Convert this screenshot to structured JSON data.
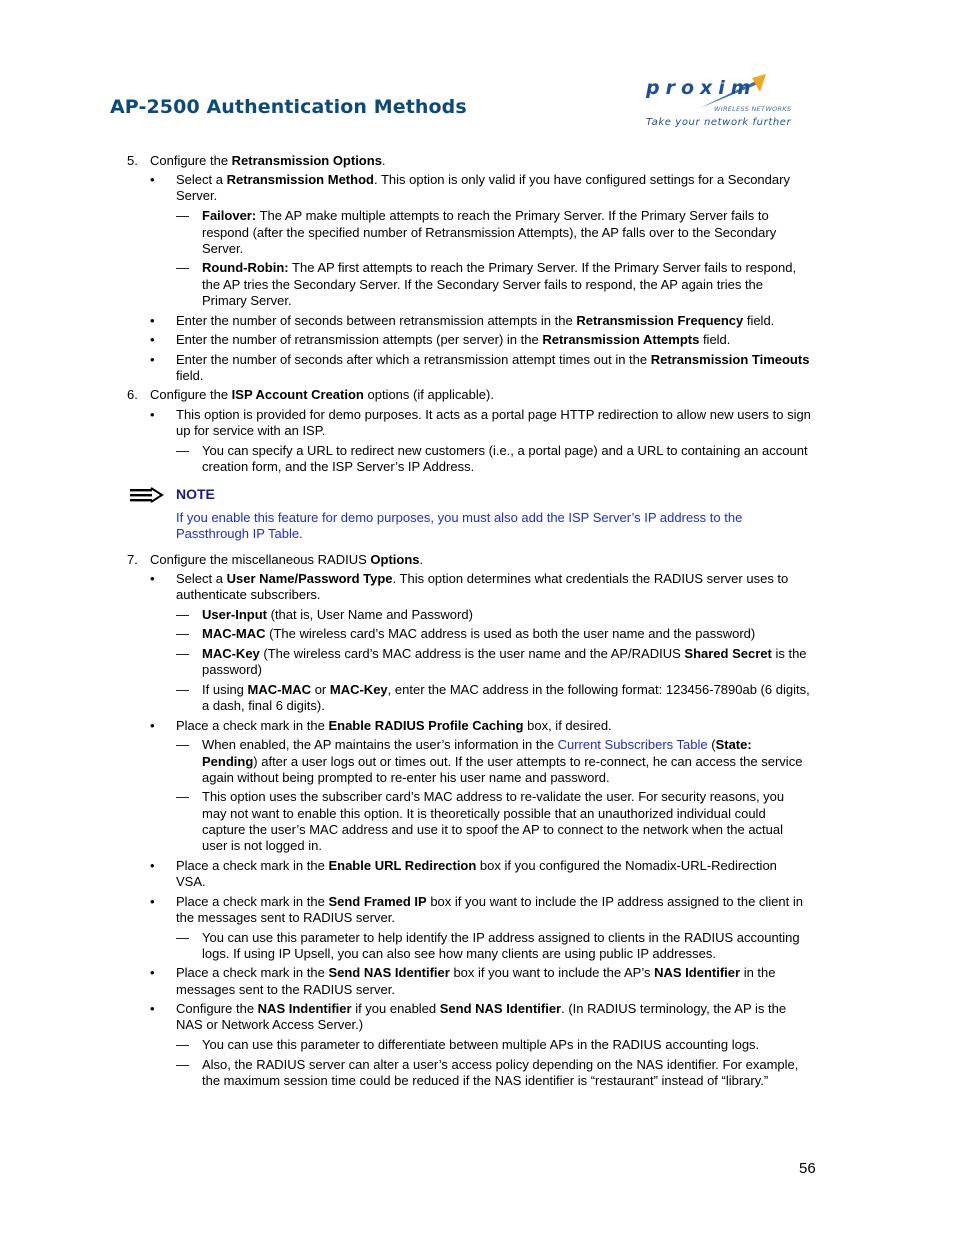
{
  "header": {
    "title": "AP-2500 Authentication Methods",
    "logo": {
      "wordmark": "proxim",
      "subtitle": "WIRELESS NETWORKS",
      "tagline": "Take your network further"
    }
  },
  "steps": {
    "s5": {
      "number": "5.",
      "pre": "Configure the ",
      "bold": "Retransmission Options",
      "post": ".",
      "b1": {
        "l1_pre": "Select a ",
        "l1_bold": "Retransmission Method",
        "l1_post": ". This option is only valid if you have configured settings for a Secondary",
        "l2": "Server.",
        "d1": {
          "l1_bold": "Failover:",
          "l1_post": " The AP make multiple attempts to reach the Primary Server. If the Primary Server fails to",
          "l2": "respond (after the specified number of Retransmission Attempts), the AP falls over to the Secondary",
          "l3": "Server."
        },
        "d2": {
          "l1_bold": "Round-Robin:",
          "l1_post": " The AP first attempts to reach the Primary Server. If the Primary Server fails to respond,",
          "l2": "the AP tries the Secondary Server. If the Secondary Server fails to respond, the AP again tries the",
          "l3": "Primary Server."
        }
      },
      "b2": {
        "pre": "Enter the number of seconds between retransmission attempts in the ",
        "bold": "Retransmission Frequency",
        "post": " field."
      },
      "b3": {
        "pre": "Enter the number of retransmission attempts (per server) in the ",
        "bold": "Retransmission Attempts",
        "post": " field."
      },
      "b4": {
        "pre": "Enter the number of seconds after which a retransmission attempt times out in the ",
        "bold": "Retransmission Timeouts",
        "l2": "field."
      }
    },
    "s6": {
      "number": "6.",
      "pre": "Configure the ",
      "bold": "ISP Account Creation",
      "post": " options (if applicable).",
      "b1": {
        "l1": "This option is provided for demo purposes. It acts as a portal page HTTP redirection to allow new users to sign",
        "l2": "up for service with an ISP.",
        "d1": {
          "l1": "You can specify a URL to redirect new customers (i.e., a portal page) and a URL to containing an account",
          "l2": "creation form, and the ISP Server’s IP Address."
        }
      }
    },
    "note": {
      "heading": "NOTE",
      "l1": "If you enable this feature for demo purposes, you must also add the ISP Server’s IP address to the",
      "l2": "Passthrough IP Table."
    },
    "s7": {
      "number": "7.",
      "pre": "Configure the miscellaneous RADIUS ",
      "bold": "Options",
      "post": ".",
      "b1": {
        "l1_pre": "Select a ",
        "l1_bold": "User Name/Password Type",
        "l1_post": ". This option determines what credentials the RADIUS server uses to",
        "l2": "authenticate subscribers.",
        "d1": {
          "bold": "User-Input",
          "post": " (that is, User Name and Password)"
        },
        "d2": {
          "bold": "MAC-MAC",
          "post": " (The wireless card’s MAC address is used as both the user name and the password)"
        },
        "d3": {
          "bold": "MAC-Key",
          "mid": " (The wireless card’s MAC address is the user name and the AP/RADIUS ",
          "bold2": "Shared Secret",
          "post": " is the",
          "l2": "password)"
        },
        "d4": {
          "pre": "If using ",
          "bold": "MAC-MAC",
          "mid": " or ",
          "bold2": "MAC-Key",
          "post": ", enter the MAC address in the following format: 123456-7890ab (6 digits,",
          "l2": "a dash, final 6 digits)."
        }
      },
      "b2": {
        "pre": "Place a check mark in the ",
        "bold": "Enable RADIUS Profile Caching",
        "post": " box, if desired.",
        "d1": {
          "pre": "When enabled, the AP maintains the user’s information in the ",
          "link": "Current Subscribers Table",
          "mid": " (",
          "bold": "State:",
          "l2_bold": "Pending",
          "l2_post": ") after a user logs out or times out. If the user attempts to re-connect, he can access the service",
          "l3": "again without being prompted to re-enter his user name and password."
        },
        "d2": {
          "l1": "This option uses the subscriber card’s MAC address to re-validate the user. For security reasons, you",
          "l2": "may not want to enable this option. It is theoretically possible that an unauthorized individual could",
          "l3": "capture the user’s MAC address and use it to spoof the AP to connect to the network when the actual",
          "l4": "user is not logged in."
        }
      },
      "b3": {
        "pre": "Place a check mark in the ",
        "bold": "Enable URL Redirection",
        "post": " box if you configured the Nomadix-URL-Redirection",
        "l2": "VSA."
      },
      "b4": {
        "pre": "Place a check mark in the ",
        "bold": "Send Framed IP",
        "post": " box if you want to include the IP address assigned to the client in",
        "l2": "the messages sent to RADIUS server.",
        "d1": {
          "l1": "You can use this parameter to help identify the IP address assigned to clients in the RADIUS accounting",
          "l2": "logs. If using IP Upsell, you can also see how many clients are using public IP addresses."
        }
      },
      "b5": {
        "pre": "Place a check mark in the ",
        "bold": "Send NAS Identifier",
        "mid": " box if you want to include the AP’s ",
        "bold2": "NAS Identifier",
        "post": " in the",
        "l2": "messages sent to the RADIUS server."
      },
      "b6": {
        "pre": "Configure the ",
        "bold": "NAS Indentifier",
        "mid": " if you enabled ",
        "bold2": "Send NAS Identifier",
        "post": ". (In RADIUS terminology, the AP is the",
        "l2": "NAS or Network Access Server.)",
        "d1": {
          "l1": "You can use this parameter to differentiate between multiple APs in the RADIUS accounting logs."
        },
        "d2": {
          "l1": "Also, the RADIUS server can alter a user’s access policy depending on the NAS identifier. For example,",
          "l2": "the maximum session time could be reduced if the NAS identifier is “restaurant” instead of “library.”"
        }
      }
    }
  },
  "symbols": {
    "bullet": "•",
    "dash": "—"
  },
  "footer": {
    "page_number": "56"
  }
}
